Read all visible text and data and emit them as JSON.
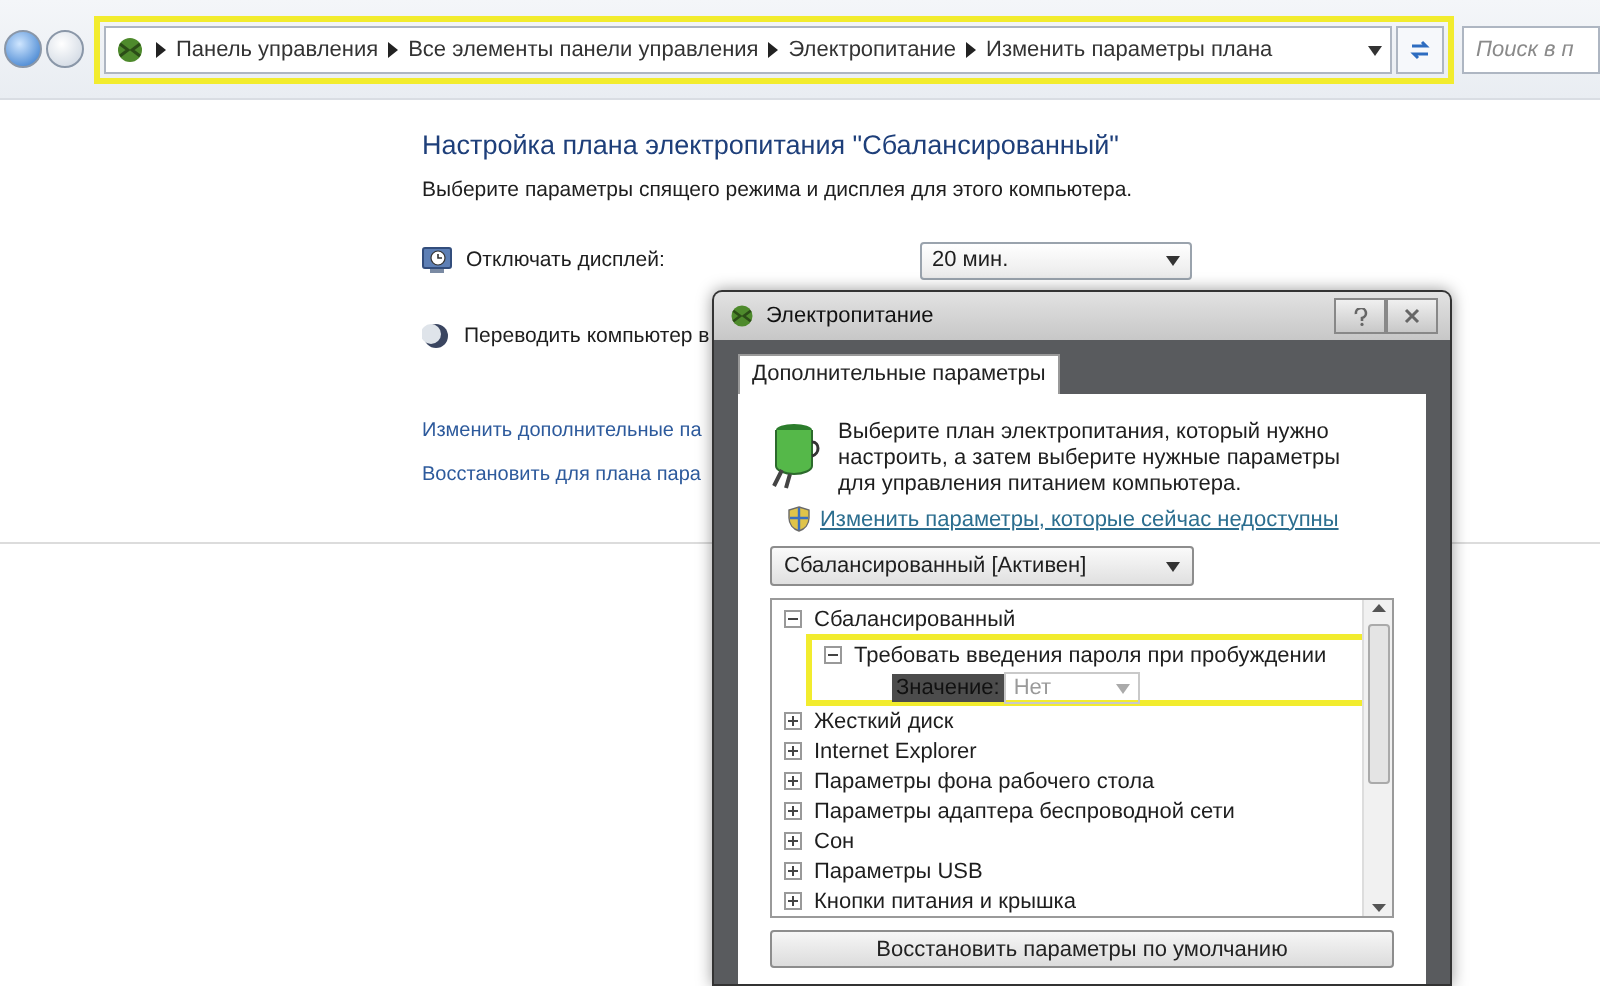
{
  "nav": {
    "breadcrumbs": [
      "Панель управления",
      "Все элементы панели управления",
      "Электропитание",
      "Изменить параметры плана"
    ],
    "search": {
      "placeholder": "Поиск в п"
    }
  },
  "page": {
    "title": "Настройка плана электропитания \"Сбалансированный\"",
    "subtitle": "Выберите параметры спящего режима и дисплея для этого компьютера.",
    "settings": [
      {
        "kind": "display",
        "label": "Отключать дисплей:",
        "value": "20 мин."
      },
      {
        "kind": "sleep",
        "label": "Переводить компьютер в"
      }
    ],
    "links": [
      "Изменить дополнительные па",
      "Восстановить для плана пара"
    ]
  },
  "dialog": {
    "title": "Электропитание",
    "tabs": [
      {
        "label": "Дополнительные параметры",
        "selected": true
      }
    ],
    "description": "Выберите план электропитания, который нужно настроить, а затем выберите нужные параметры для управления питанием компьютера.",
    "admin_link": "Изменить параметры, которые сейчас недоступны",
    "plan": "Сбалансированный [Активен]",
    "tree": [
      {
        "label": "Сбалансированный",
        "expanded": true,
        "children": [
          {
            "label": "Требовать введения пароля при пробуждении",
            "expanded": true,
            "setting": {
              "label": "Значение:",
              "selected": true,
              "value": "Нет",
              "disabled": true
            }
          }
        ]
      },
      {
        "label": "Жесткий диск",
        "expanded": false
      },
      {
        "label": "Internet Explorer",
        "expanded": false
      },
      {
        "label": "Параметры фона рабочего стола",
        "expanded": false
      },
      {
        "label": "Параметры адаптера беспроводной сети",
        "expanded": false
      },
      {
        "label": "Сон",
        "expanded": false
      },
      {
        "label": "Параметры USB",
        "expanded": false
      },
      {
        "label": "Кнопки питания и крышка",
        "expanded": false
      }
    ],
    "restore_button": "Восстановить параметры по умолчанию"
  }
}
